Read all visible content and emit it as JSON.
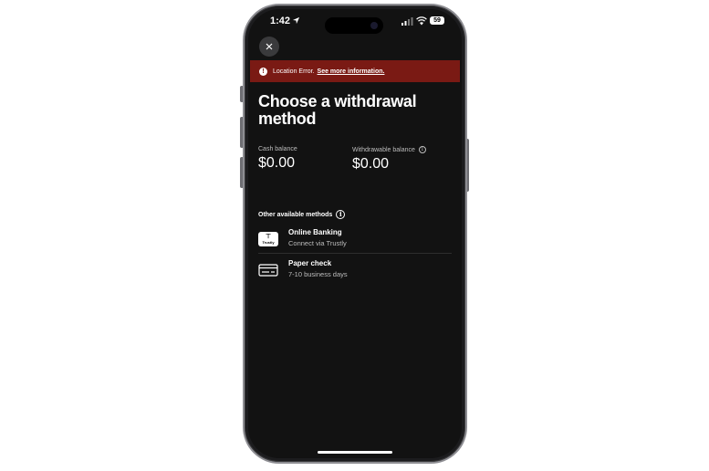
{
  "status_bar": {
    "time": "1:42",
    "battery": "59"
  },
  "banner": {
    "text": "Location Error.",
    "link": "See more information.",
    "icon": "exclamation-icon",
    "color": "#7a1a14"
  },
  "page": {
    "title": "Choose a withdrawal method"
  },
  "balances": {
    "cash_label": "Cash balance",
    "cash_value": "$0.00",
    "withdrawable_label": "Withdrawable balance",
    "withdrawable_value": "$0.00"
  },
  "methods": {
    "section_label": "Other available methods",
    "items": [
      {
        "title": "Online Banking",
        "subtitle": "Connect via Trustly",
        "icon": "trustly-icon",
        "icon_text": "Trustly"
      },
      {
        "title": "Paper check",
        "subtitle": "7-10 business days",
        "icon": "check-card-icon"
      }
    ]
  },
  "colors": {
    "background": "#121212",
    "error": "#7a1a14",
    "text_secondary": "#bdbdbd"
  }
}
